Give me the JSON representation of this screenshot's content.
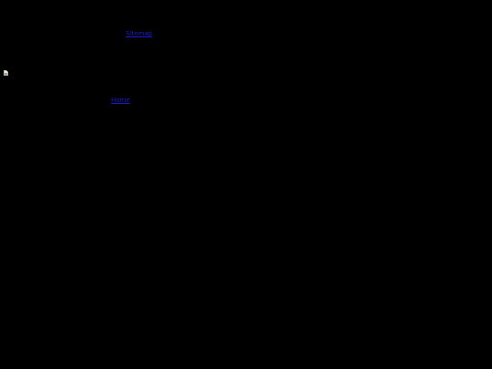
{
  "page": {
    "background_color": "#000000",
    "link_color": "#1a1acc"
  },
  "links": {
    "top_label": "Sitemap",
    "bottom_label": "Home"
  },
  "image": {
    "icon": "broken-image-icon"
  }
}
